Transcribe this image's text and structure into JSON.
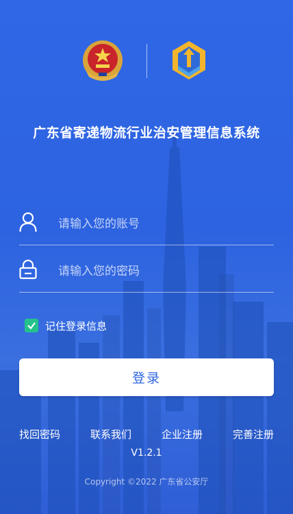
{
  "app": {
    "title": "广东省寄递物流行业治安管理信息系统"
  },
  "logos": {
    "left": "police-emblem",
    "right": "postal-security-logo"
  },
  "login_form": {
    "username_placeholder": "请输入您的账号",
    "password_placeholder": "请输入您的密码",
    "remember_label": "记住登录信息",
    "remember_checked": true,
    "submit_label": "登录"
  },
  "footer_links": [
    "找回密码",
    "联系我们",
    "企业注册",
    "完善注册"
  ],
  "version": "V1.2.1",
  "copyright": "Copyright ©2022 广东省公安厅",
  "colors": {
    "primary": "#2f66e0",
    "checkbox": "#24c28a",
    "text": "#ffffff"
  }
}
